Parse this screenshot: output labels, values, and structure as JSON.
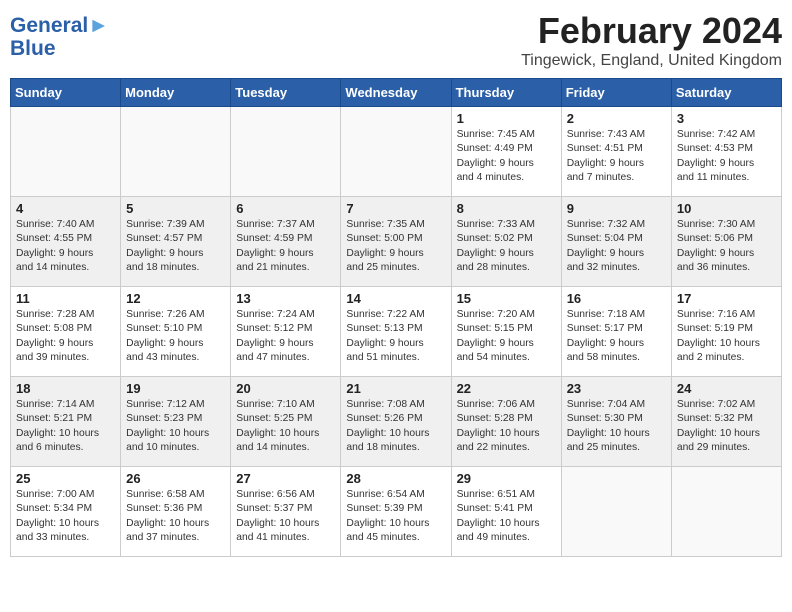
{
  "logo": {
    "line1": "General",
    "line2": "Blue"
  },
  "title": "February 2024",
  "location": "Tingewick, England, United Kingdom",
  "days_of_week": [
    "Sunday",
    "Monday",
    "Tuesday",
    "Wednesday",
    "Thursday",
    "Friday",
    "Saturday"
  ],
  "weeks": [
    [
      {
        "day": "",
        "info": ""
      },
      {
        "day": "",
        "info": ""
      },
      {
        "day": "",
        "info": ""
      },
      {
        "day": "",
        "info": ""
      },
      {
        "day": "1",
        "info": "Sunrise: 7:45 AM\nSunset: 4:49 PM\nDaylight: 9 hours\nand 4 minutes."
      },
      {
        "day": "2",
        "info": "Sunrise: 7:43 AM\nSunset: 4:51 PM\nDaylight: 9 hours\nand 7 minutes."
      },
      {
        "day": "3",
        "info": "Sunrise: 7:42 AM\nSunset: 4:53 PM\nDaylight: 9 hours\nand 11 minutes."
      }
    ],
    [
      {
        "day": "4",
        "info": "Sunrise: 7:40 AM\nSunset: 4:55 PM\nDaylight: 9 hours\nand 14 minutes."
      },
      {
        "day": "5",
        "info": "Sunrise: 7:39 AM\nSunset: 4:57 PM\nDaylight: 9 hours\nand 18 minutes."
      },
      {
        "day": "6",
        "info": "Sunrise: 7:37 AM\nSunset: 4:59 PM\nDaylight: 9 hours\nand 21 minutes."
      },
      {
        "day": "7",
        "info": "Sunrise: 7:35 AM\nSunset: 5:00 PM\nDaylight: 9 hours\nand 25 minutes."
      },
      {
        "day": "8",
        "info": "Sunrise: 7:33 AM\nSunset: 5:02 PM\nDaylight: 9 hours\nand 28 minutes."
      },
      {
        "day": "9",
        "info": "Sunrise: 7:32 AM\nSunset: 5:04 PM\nDaylight: 9 hours\nand 32 minutes."
      },
      {
        "day": "10",
        "info": "Sunrise: 7:30 AM\nSunset: 5:06 PM\nDaylight: 9 hours\nand 36 minutes."
      }
    ],
    [
      {
        "day": "11",
        "info": "Sunrise: 7:28 AM\nSunset: 5:08 PM\nDaylight: 9 hours\nand 39 minutes."
      },
      {
        "day": "12",
        "info": "Sunrise: 7:26 AM\nSunset: 5:10 PM\nDaylight: 9 hours\nand 43 minutes."
      },
      {
        "day": "13",
        "info": "Sunrise: 7:24 AM\nSunset: 5:12 PM\nDaylight: 9 hours\nand 47 minutes."
      },
      {
        "day": "14",
        "info": "Sunrise: 7:22 AM\nSunset: 5:13 PM\nDaylight: 9 hours\nand 51 minutes."
      },
      {
        "day": "15",
        "info": "Sunrise: 7:20 AM\nSunset: 5:15 PM\nDaylight: 9 hours\nand 54 minutes."
      },
      {
        "day": "16",
        "info": "Sunrise: 7:18 AM\nSunset: 5:17 PM\nDaylight: 9 hours\nand 58 minutes."
      },
      {
        "day": "17",
        "info": "Sunrise: 7:16 AM\nSunset: 5:19 PM\nDaylight: 10 hours\nand 2 minutes."
      }
    ],
    [
      {
        "day": "18",
        "info": "Sunrise: 7:14 AM\nSunset: 5:21 PM\nDaylight: 10 hours\nand 6 minutes."
      },
      {
        "day": "19",
        "info": "Sunrise: 7:12 AM\nSunset: 5:23 PM\nDaylight: 10 hours\nand 10 minutes."
      },
      {
        "day": "20",
        "info": "Sunrise: 7:10 AM\nSunset: 5:25 PM\nDaylight: 10 hours\nand 14 minutes."
      },
      {
        "day": "21",
        "info": "Sunrise: 7:08 AM\nSunset: 5:26 PM\nDaylight: 10 hours\nand 18 minutes."
      },
      {
        "day": "22",
        "info": "Sunrise: 7:06 AM\nSunset: 5:28 PM\nDaylight: 10 hours\nand 22 minutes."
      },
      {
        "day": "23",
        "info": "Sunrise: 7:04 AM\nSunset: 5:30 PM\nDaylight: 10 hours\nand 25 minutes."
      },
      {
        "day": "24",
        "info": "Sunrise: 7:02 AM\nSunset: 5:32 PM\nDaylight: 10 hours\nand 29 minutes."
      }
    ],
    [
      {
        "day": "25",
        "info": "Sunrise: 7:00 AM\nSunset: 5:34 PM\nDaylight: 10 hours\nand 33 minutes."
      },
      {
        "day": "26",
        "info": "Sunrise: 6:58 AM\nSunset: 5:36 PM\nDaylight: 10 hours\nand 37 minutes."
      },
      {
        "day": "27",
        "info": "Sunrise: 6:56 AM\nSunset: 5:37 PM\nDaylight: 10 hours\nand 41 minutes."
      },
      {
        "day": "28",
        "info": "Sunrise: 6:54 AM\nSunset: 5:39 PM\nDaylight: 10 hours\nand 45 minutes."
      },
      {
        "day": "29",
        "info": "Sunrise: 6:51 AM\nSunset: 5:41 PM\nDaylight: 10 hours\nand 49 minutes."
      },
      {
        "day": "",
        "info": ""
      },
      {
        "day": "",
        "info": ""
      }
    ]
  ]
}
